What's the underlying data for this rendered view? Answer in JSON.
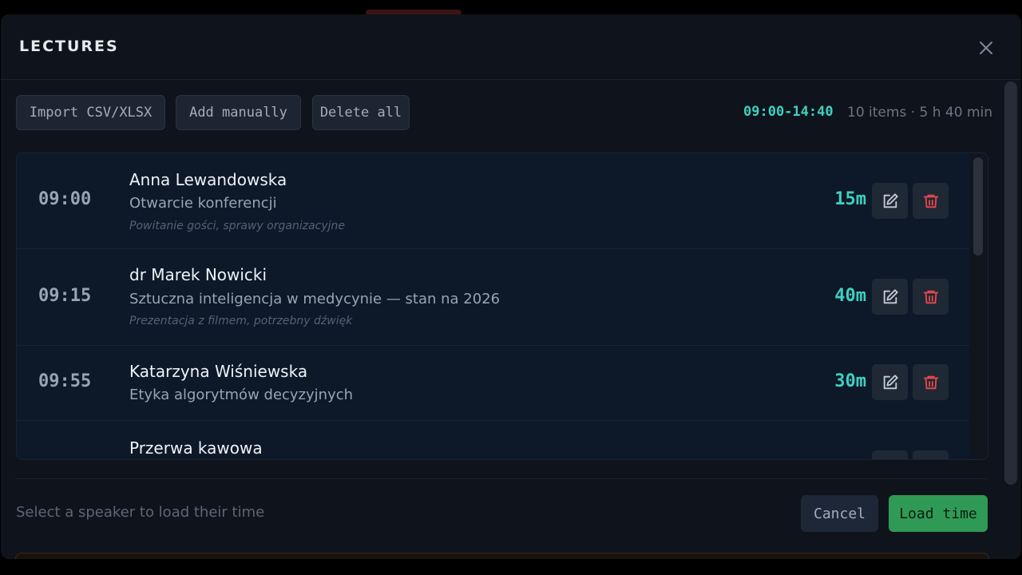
{
  "header": {
    "title": "LECTURES",
    "close_icon": "close-icon"
  },
  "toolbar": {
    "import_label": "Import CSV/XLSX",
    "add_label": "Add manually",
    "delete_all_label": "Delete all",
    "range": "09:00-14:40",
    "summary": "10 items · 5 h 40 min"
  },
  "lectures": [
    {
      "time": "09:00",
      "speaker": "Anna Lewandowska",
      "title": "Otwarcie konferencji",
      "note": "Powitanie gości, sprawy organizacyjne",
      "duration": "15m"
    },
    {
      "time": "09:15",
      "speaker": "dr Marek Nowicki",
      "title": "Sztuczna inteligencja w medycynie — stan na 2026",
      "note": "Prezentacja z filmem, potrzebny dźwięk",
      "duration": "40m"
    },
    {
      "time": "09:55",
      "speaker": "Katarzyna Wiśniewska",
      "title": "Etyka algorytmów decyzyjnych",
      "note": "",
      "duration": "30m"
    },
    {
      "time": "",
      "speaker": "Przerwa kawowa",
      "title": "",
      "note": "",
      "duration": ""
    }
  ],
  "icons": {
    "edit": "edit-icon",
    "delete": "trash-icon"
  },
  "colors": {
    "accent": "#3fd0c0",
    "danger": "#e5484d",
    "primary": "#2f9a55"
  },
  "footer": {
    "hint": "Select a speaker to load their time",
    "cancel_label": "Cancel",
    "load_label": "Load time"
  }
}
